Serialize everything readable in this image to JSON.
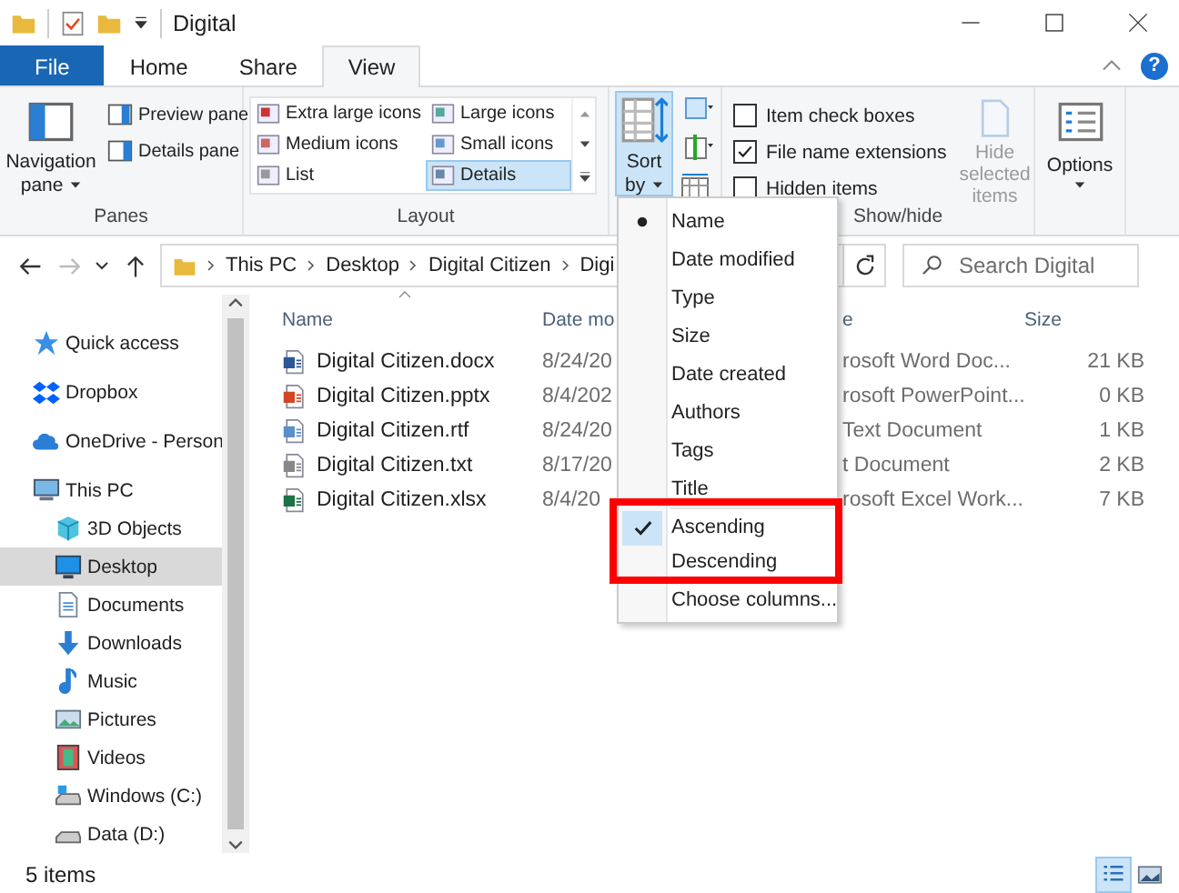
{
  "window": {
    "title": "Digital"
  },
  "tabs": [
    {
      "label": "File",
      "kind": "file",
      "selected": false
    },
    {
      "label": "Home",
      "kind": "tab",
      "selected": false
    },
    {
      "label": "Share",
      "kind": "tab",
      "selected": false
    },
    {
      "label": "View",
      "kind": "tab",
      "selected": true
    }
  ],
  "help_button": "?",
  "ribbon": {
    "panes": {
      "label": "Panes",
      "navigation_pane": "Navigation pane",
      "items": [
        "Preview pane",
        "Details pane"
      ]
    },
    "layout": {
      "label": "Layout",
      "options": [
        {
          "label": "Extra large icons",
          "selected": false
        },
        {
          "label": "Large icons",
          "selected": false
        },
        {
          "label": "Medium icons",
          "selected": false
        },
        {
          "label": "Small icons",
          "selected": false
        },
        {
          "label": "List",
          "selected": false
        },
        {
          "label": "Details",
          "selected": true
        }
      ]
    },
    "current_view": {
      "sort_by": {
        "label": "Sort by",
        "expanded": true
      }
    },
    "show_hide": {
      "label": "Show/hide",
      "checkboxes": [
        {
          "label": "Item check boxes",
          "checked": false
        },
        {
          "label": "File name extensions",
          "checked": true
        },
        {
          "label": "Hidden items",
          "checked": false
        }
      ],
      "hide_selected": {
        "label": "Hide selected items",
        "disabled": true
      }
    },
    "options": {
      "label": "Options"
    }
  },
  "address": {
    "forward": {
      "disabled": true
    },
    "crumbs": [
      "This PC",
      "Desktop",
      "Digital Citizen",
      "Digi"
    ]
  },
  "search": {
    "placeholder": "Search Digital"
  },
  "nav": [
    {
      "label": "Quick access",
      "selected": false
    },
    {
      "label": "Dropbox",
      "selected": false
    },
    {
      "label": "OneDrive - Person",
      "selected": false
    },
    {
      "label": "This PC",
      "selected": false,
      "children": [
        {
          "label": "3D Objects",
          "selected": false
        },
        {
          "label": "Desktop",
          "selected": true
        },
        {
          "label": "Documents",
          "selected": false
        },
        {
          "label": "Downloads",
          "selected": false
        },
        {
          "label": "Music",
          "selected": false
        },
        {
          "label": "Pictures",
          "selected": false
        },
        {
          "label": "Videos",
          "selected": false
        },
        {
          "label": "Windows (C:)",
          "selected": false
        },
        {
          "label": "Data (D:)",
          "selected": false
        }
      ]
    }
  ],
  "files": {
    "columns": [
      "Name",
      "Date mo",
      "e",
      "Size"
    ],
    "rows": [
      {
        "name": "Digital Citizen.docx",
        "date": "8/24/20",
        "type": "rosoft Word Doc...",
        "size": "21 KB"
      },
      {
        "name": "Digital Citizen.pptx",
        "date": "8/4/202",
        "type": "rosoft PowerPoint...",
        "size": "0 KB"
      },
      {
        "name": "Digital Citizen.rtf",
        "date": "8/24/20",
        "type": "Text Document",
        "size": "1 KB"
      },
      {
        "name": "Digital Citizen.txt",
        "date": "8/17/20",
        "type": "t Document",
        "size": "2 KB"
      },
      {
        "name": "Digital Citizen.xlsx",
        "date": "8/4/20",
        "type": "rosoft Excel Work...",
        "size": "7 KB"
      }
    ]
  },
  "menu": {
    "sort_fields": [
      {
        "label": "Name",
        "selected": true
      },
      {
        "label": "Date modified",
        "selected": false
      },
      {
        "label": "Type",
        "selected": false
      },
      {
        "label": "Size",
        "selected": false
      },
      {
        "label": "Date created",
        "selected": false
      },
      {
        "label": "Authors",
        "selected": false
      },
      {
        "label": "Tags",
        "selected": false
      },
      {
        "label": "Title",
        "selected": false
      }
    ],
    "sort_orders": [
      {
        "label": "Ascending",
        "selected": true
      },
      {
        "label": "Descending",
        "selected": false
      }
    ],
    "footer": "Choose columns..."
  },
  "status": {
    "count": "5 items",
    "views": [
      {
        "selected": true
      },
      {
        "selected": false
      }
    ]
  }
}
